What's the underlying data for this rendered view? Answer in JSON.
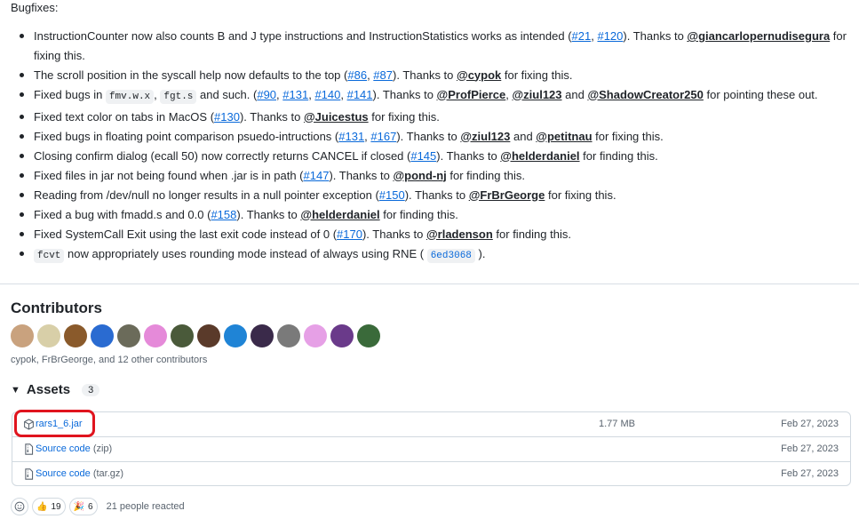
{
  "release": {
    "heading": "Bugfixes:",
    "fixes": [
      [
        {
          "t": "InstructionCounter now also counts B and J type instructions and InstructionStatistics works as intended ("
        },
        {
          "l": "#21"
        },
        {
          "t": ", "
        },
        {
          "l": "#120"
        },
        {
          "t": "). Thanks to "
        },
        {
          "m": "@giancarlopernudisegura"
        },
        {
          "t": " for"
        },
        {
          "br": true
        },
        {
          "t": "fixing this."
        }
      ],
      [
        {
          "t": "The scroll position in the syscall help now defaults to the top ("
        },
        {
          "l": "#86"
        },
        {
          "t": ", "
        },
        {
          "l": "#87"
        },
        {
          "t": "). Thanks to "
        },
        {
          "m": "@cypok"
        },
        {
          "t": " for fixing this."
        }
      ],
      [
        {
          "t": "Fixed bugs in "
        },
        {
          "c": "fmv.w.x"
        },
        {
          "t": ", "
        },
        {
          "c": "fgt.s"
        },
        {
          "t": " and such. ("
        },
        {
          "l": "#90"
        },
        {
          "t": ", "
        },
        {
          "l": "#131"
        },
        {
          "t": ", "
        },
        {
          "l": "#140"
        },
        {
          "t": ", "
        },
        {
          "l": "#141"
        },
        {
          "t": "). Thanks to "
        },
        {
          "m": "@ProfPierce"
        },
        {
          "t": ", "
        },
        {
          "m": "@ziul123"
        },
        {
          "t": " and "
        },
        {
          "m": "@ShadowCreator250"
        },
        {
          "t": " for pointing these out."
        }
      ],
      [
        {
          "t": "Fixed text color on tabs in MacOS ("
        },
        {
          "l": "#130"
        },
        {
          "t": "). Thanks to "
        },
        {
          "m": "@Juicestus"
        },
        {
          "t": " for fixing this."
        }
      ],
      [
        {
          "t": "Fixed bugs in floating point comparison psuedo-intructions ("
        },
        {
          "l": "#131"
        },
        {
          "t": ", "
        },
        {
          "l": "#167"
        },
        {
          "t": "). Thanks to "
        },
        {
          "m": "@ziul123"
        },
        {
          "t": " and "
        },
        {
          "m": "@petitnau"
        },
        {
          "t": " for fixing this."
        }
      ],
      [
        {
          "t": "Closing confirm dialog (ecall 50) now correctly returns CANCEL if closed ("
        },
        {
          "l": "#145"
        },
        {
          "t": "). Thanks to "
        },
        {
          "m": "@helderdaniel"
        },
        {
          "t": " for finding this."
        }
      ],
      [
        {
          "t": "Fixed files in jar not being found when .jar is in path ("
        },
        {
          "l": "#147"
        },
        {
          "t": "). Thanks to "
        },
        {
          "m": "@pond-nj"
        },
        {
          "t": " for finding this."
        }
      ],
      [
        {
          "t": "Reading from /dev/null no longer results in a null pointer exception ("
        },
        {
          "l": "#150"
        },
        {
          "t": "). Thanks to "
        },
        {
          "m": "@FrBrGeorge"
        },
        {
          "t": " for fixing this."
        }
      ],
      [
        {
          "t": "Fixed a bug with fmadd.s and 0.0 ("
        },
        {
          "l": "#158"
        },
        {
          "t": "). Thanks to "
        },
        {
          "m": "@helderdaniel"
        },
        {
          "t": " for finding this."
        }
      ],
      [
        {
          "t": "Fixed SystemCall Exit using the last exit code instead of 0 ("
        },
        {
          "l": "#170"
        },
        {
          "t": "). Thanks to "
        },
        {
          "m": "@rladenson"
        },
        {
          "t": " for finding this."
        }
      ],
      [
        {
          "c": "fcvt"
        },
        {
          "t": " now appropriately uses rounding mode instead of always using RNE ( "
        },
        {
          "sha": "6ed3068"
        },
        {
          "t": " )."
        }
      ]
    ]
  },
  "contributors": {
    "title": "Contributors",
    "avatars": [
      "#c9a27e",
      "#d8cfa8",
      "#8a5a2b",
      "#2a6bd1",
      "#6b6b5a",
      "#e58ad9",
      "#4a5a3a",
      "#5a3a2a",
      "#1f84d6",
      "#3a2a4a",
      "#7a7a7a",
      "#e6a0e6",
      "#6a3a8a",
      "#3a6a3a"
    ],
    "summary": "cypok, FrBrGeorge, and 12 other contributors"
  },
  "assets": {
    "title": "Assets",
    "count": "3",
    "items": [
      {
        "name": "rars1_6.jar",
        "sub": "",
        "size": "1.77 MB",
        "date": "Feb 27, 2023",
        "icon": "package-icon"
      },
      {
        "name": "Source code",
        "sub": "(zip)",
        "size": "",
        "date": "Feb 27, 2023",
        "icon": "file-zip-icon"
      },
      {
        "name": "Source code",
        "sub": "(tar.gz)",
        "size": "",
        "date": "Feb 27, 2023",
        "icon": "file-zip-icon"
      }
    ]
  },
  "reactions": {
    "thumbs_count": "19",
    "party_count": "6",
    "summary": "21 people reacted"
  },
  "colors": {
    "link": "#0969da",
    "highlight": "#e0141e",
    "border": "#d1d9e0"
  }
}
